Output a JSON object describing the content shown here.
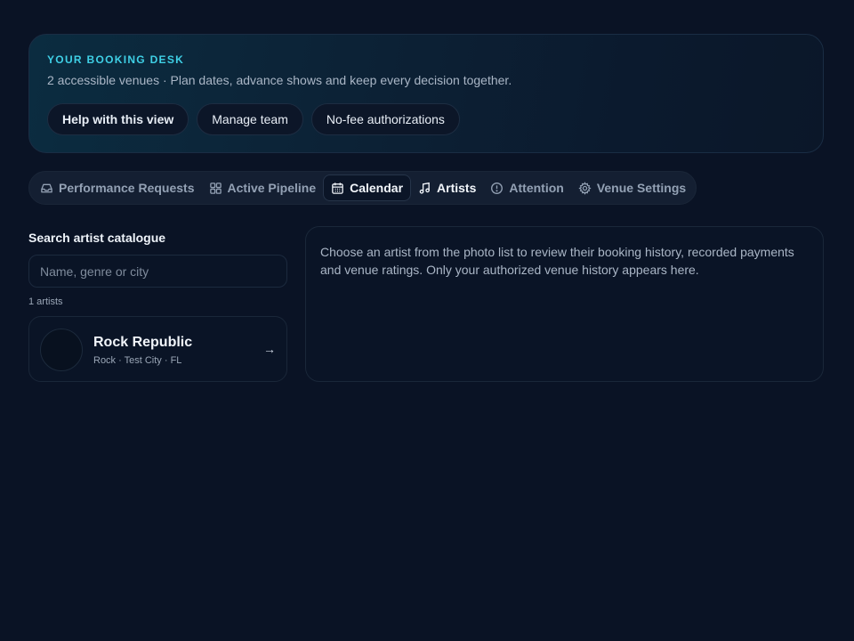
{
  "hero": {
    "eyebrow": "YOUR BOOKING DESK",
    "subtitle": "2 accessible venues · Plan dates, advance shows and keep every decision together.",
    "buttons": [
      {
        "label": "Help with this view"
      },
      {
        "label": "Manage team"
      },
      {
        "label": "No-fee authorizations"
      }
    ]
  },
  "tabs": [
    {
      "label": "Performance Requests",
      "icon": "inbox-icon"
    },
    {
      "label": "Active Pipeline",
      "icon": "grid-icon"
    },
    {
      "label": "Calendar",
      "icon": "calendar-icon",
      "active": true
    },
    {
      "label": "Artists",
      "icon": "music-note-icon"
    },
    {
      "label": "Attention",
      "icon": "alert-circle-icon"
    },
    {
      "label": "Venue Settings",
      "icon": "gear-icon"
    }
  ],
  "search": {
    "title": "Search artist catalogue",
    "placeholder": "Name, genre or city",
    "value": "",
    "count_label": "1 artists"
  },
  "artists": [
    {
      "name": "Rock Republic",
      "meta": "Rock · Test City · FL",
      "arrow": "→"
    }
  ],
  "detail": {
    "text": "Choose an artist from the photo list to review their booking history, recorded payments and venue ratings. Only your authorized venue history appears here."
  },
  "colors": {
    "background": "#0a1325",
    "accent": "#3fd0e6"
  }
}
